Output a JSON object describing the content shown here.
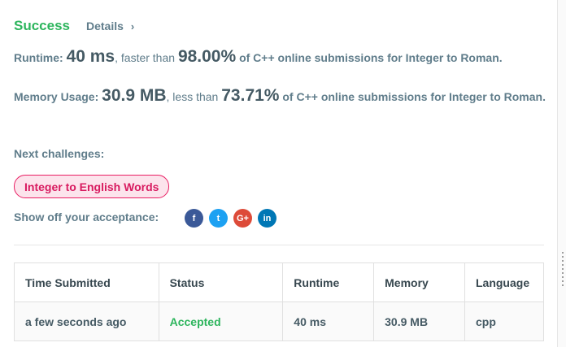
{
  "result": {
    "status": "Success",
    "details_label": "Details",
    "details_chevron": "›"
  },
  "runtime": {
    "label": "Runtime:",
    "value": "40 ms",
    "comparison": ", faster than",
    "percent": "98.00%",
    "suffix": "of C++ online submissions for Integer to Roman."
  },
  "memory": {
    "label": "Memory Usage:",
    "value": "30.9 MB",
    "comparison": ", less than",
    "percent": "73.71%",
    "suffix": "of C++ online submissions for Integer to Roman."
  },
  "next_challenges": {
    "label": "Next challenges:",
    "items": [
      {
        "label": "Integer to English Words"
      }
    ]
  },
  "share": {
    "label": "Show off your acceptance:",
    "icons": [
      {
        "name": "facebook-icon",
        "glyph": "f",
        "color": "#3b5998"
      },
      {
        "name": "twitter-icon",
        "glyph": "t",
        "color": "#1da1f2"
      },
      {
        "name": "google-plus-icon",
        "glyph": "G+",
        "color": "#dd4b39"
      },
      {
        "name": "linkedin-icon",
        "glyph": "in",
        "color": "#0077b5"
      }
    ]
  },
  "submissions": {
    "headers": [
      "Time Submitted",
      "Status",
      "Runtime",
      "Memory",
      "Language"
    ],
    "rows": [
      {
        "time": "a few seconds ago",
        "status": "Accepted",
        "runtime": "40 ms",
        "memory": "30.9 MB",
        "language": "cpp"
      }
    ]
  },
  "colors": {
    "success": "#2db55d",
    "chip_border": "#e91e63",
    "chip_bg": "#fce4ec",
    "text": "#607d8b"
  }
}
